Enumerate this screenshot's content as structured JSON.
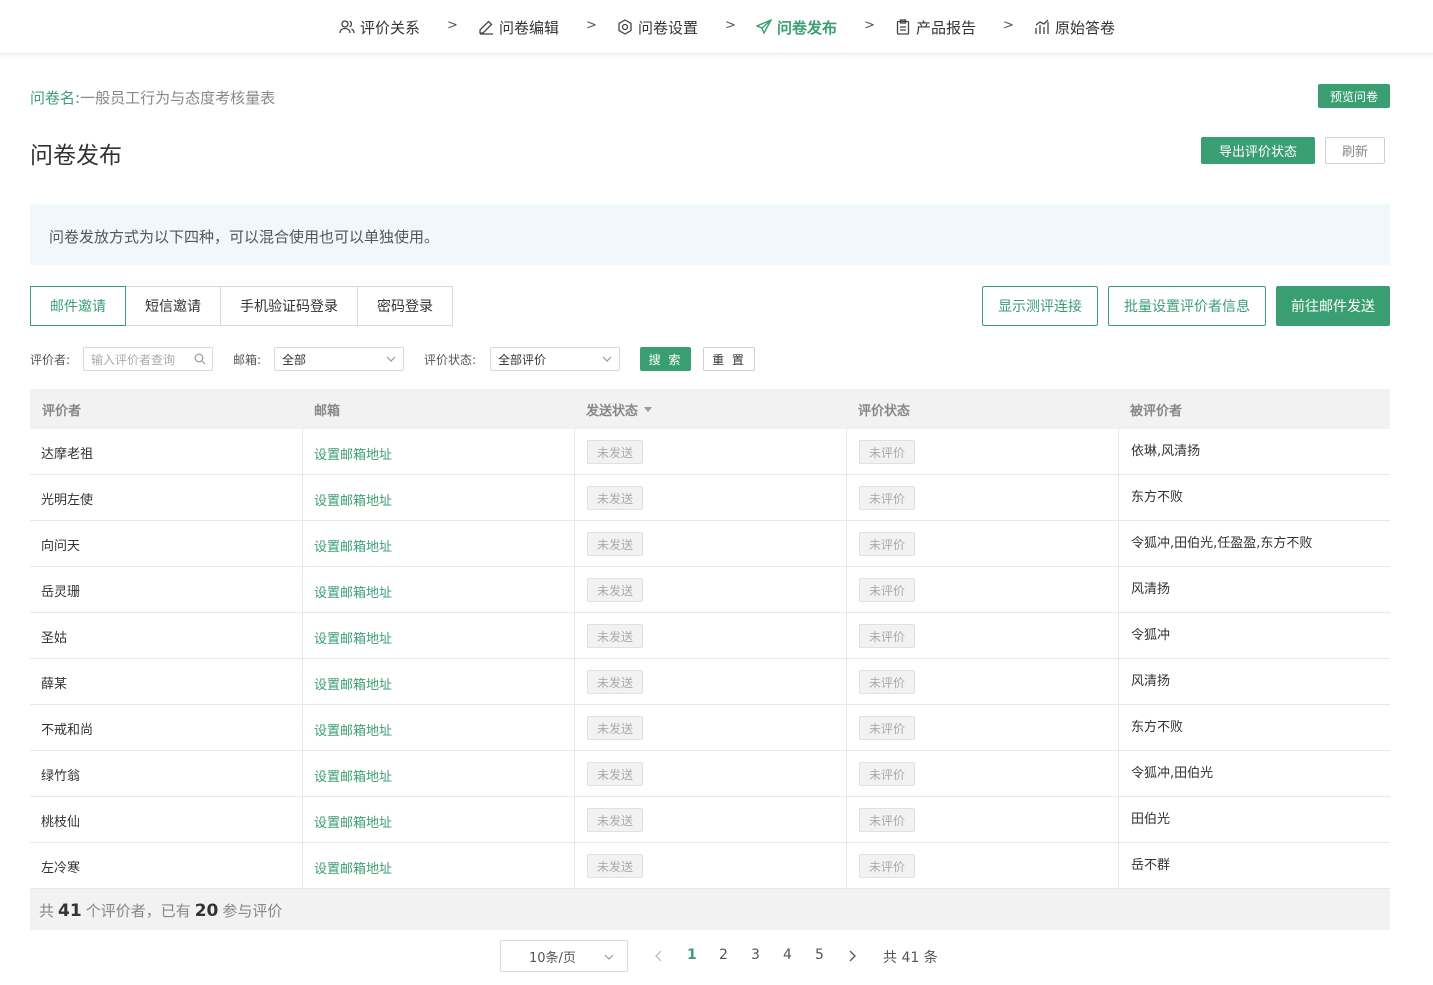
{
  "nav": {
    "steps": [
      {
        "label": "评价关系",
        "icon": "users-icon"
      },
      {
        "label": "问卷编辑",
        "icon": "edit-icon"
      },
      {
        "label": "问卷设置",
        "icon": "settings-icon"
      },
      {
        "label": "问卷发布",
        "icon": "send-icon"
      },
      {
        "label": "产品报告",
        "icon": "clipboard-icon"
      },
      {
        "label": "原始答卷",
        "icon": "chart-icon"
      }
    ],
    "separator": ">",
    "active_index": 3
  },
  "questionnaire": {
    "name_label": "问卷名:",
    "name": "一般员工行为与态度考核量表",
    "preview_button": "预览问卷"
  },
  "page_title": "问卷发布",
  "actions": {
    "export": "导出评价状态",
    "refresh": "刷新"
  },
  "info": "问卷发放方式为以下四种，可以混合使用也可以单独使用。",
  "tabs": [
    "邮件邀请",
    "短信邀请",
    "手机验证码登录",
    "密码登录"
  ],
  "tab_active": 0,
  "tab_actions": {
    "show_link": "显示测评连接",
    "batch_set": "批量设置评价者信息",
    "go_send": "前往邮件发送"
  },
  "filters": {
    "evaluator_label": "评价者:",
    "evaluator_placeholder": "输入评价者查询",
    "email_label": "邮箱:",
    "email_value": "全部",
    "status_label": "评价状态:",
    "status_value": "全部评价",
    "search": "搜 索",
    "reset": "重 置"
  },
  "table": {
    "columns": [
      "评价者",
      "邮箱",
      "发送状态",
      "评价状态",
      "被评价者"
    ],
    "rows": [
      {
        "evaluator": "达摩老祖",
        "email": "设置邮箱地址",
        "send": "未发送",
        "status": "未评价",
        "targets": "依琳,风清扬"
      },
      {
        "evaluator": "光明左使",
        "email": "设置邮箱地址",
        "send": "未发送",
        "status": "未评价",
        "targets": "东方不败"
      },
      {
        "evaluator": "向问天",
        "email": "设置邮箱地址",
        "send": "未发送",
        "status": "未评价",
        "targets": "令狐冲,田伯光,任盈盈,东方不败"
      },
      {
        "evaluator": "岳灵珊",
        "email": "设置邮箱地址",
        "send": "未发送",
        "status": "未评价",
        "targets": "风清扬"
      },
      {
        "evaluator": "圣姑",
        "email": "设置邮箱地址",
        "send": "未发送",
        "status": "未评价",
        "targets": "令狐冲"
      },
      {
        "evaluator": "薛某",
        "email": "设置邮箱地址",
        "send": "未发送",
        "status": "未评价",
        "targets": "风清扬"
      },
      {
        "evaluator": "不戒和尚",
        "email": "设置邮箱地址",
        "send": "未发送",
        "status": "未评价",
        "targets": "东方不败"
      },
      {
        "evaluator": "绿竹翁",
        "email": "设置邮箱地址",
        "send": "未发送",
        "status": "未评价",
        "targets": "令狐冲,田伯光"
      },
      {
        "evaluator": "桃枝仙",
        "email": "设置邮箱地址",
        "send": "未发送",
        "status": "未评价",
        "targets": "田伯光"
      },
      {
        "evaluator": "左冷寒",
        "email": "设置邮箱地址",
        "send": "未发送",
        "status": "未评价",
        "targets": "岳不群"
      }
    ]
  },
  "summary": {
    "prefix": "共",
    "total": "41",
    "middle": "个评价者，已有",
    "done": "20",
    "suffix": "参与评价"
  },
  "pagination": {
    "page_size": "10条/页",
    "pages": [
      "1",
      "2",
      "3",
      "4",
      "5"
    ],
    "current": "1",
    "total_text": "共 41 条"
  },
  "colors": {
    "accent": "#3a9e73"
  }
}
